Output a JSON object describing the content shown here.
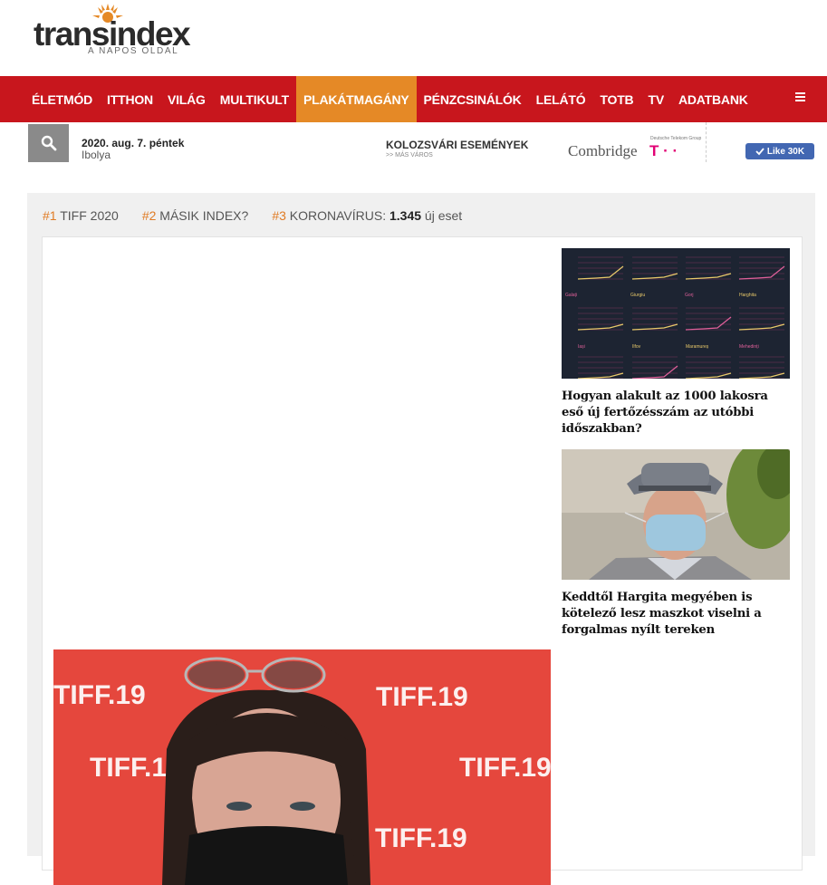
{
  "brand": {
    "name": "transindex",
    "tagline": "A NAPOS OLDAL"
  },
  "nav": {
    "items": [
      {
        "label": "ÉLETMÓD"
      },
      {
        "label": "ITTHON"
      },
      {
        "label": "VILÁG"
      },
      {
        "label": "MULTIKULT"
      },
      {
        "label": "PLAKÁTMAGÁNY",
        "active": true
      },
      {
        "label": "PÉNZCSINÁLÓK"
      },
      {
        "label": "LELÁTÓ"
      },
      {
        "label": "TOTB"
      },
      {
        "label": "TV"
      },
      {
        "label": "ADATBANK"
      }
    ],
    "menu_icon": "hamburger-icon"
  },
  "utility": {
    "search_icon": "search-icon",
    "date": "2020. aug. 7. péntek",
    "nameday": "Ibolya",
    "events_title": "KOLOZSVÁRI ESEMÉNYEK",
    "events_sub": ">> MÁS VÁROS",
    "sponsor_name": "Combridge",
    "sponsor_group": "Deutsche Telekom Group",
    "sponsor_logo": "T · ·",
    "like_label": "Like 30K"
  },
  "trending": [
    {
      "num": "#1",
      "label": "TIFF 2020"
    },
    {
      "num": "#2",
      "label": "MÁSIK INDEX?"
    },
    {
      "num": "#3",
      "label": "KORONAVÍRUS:",
      "bold": "1.345",
      "suffix": "új eset"
    }
  ],
  "side_articles": [
    {
      "title": "Hogyan alakult az 1000 lakosra eső új fertőzésszám az utóbbi időszakban?",
      "chart_labels": [
        "Galați",
        "Giurgiu",
        "Gorj",
        "Harghita",
        "Iași",
        "Ilfov",
        "Maramureș",
        "Mehedinți"
      ]
    },
    {
      "title": "Keddtől Hargita megyében is kötelező lesz maszkot viselni a forgalmas nyílt tereken"
    }
  ],
  "main_image": {
    "backdrop_text": "TIFF.19"
  },
  "colors": {
    "nav_red": "#c8161d",
    "nav_active": "#e58926",
    "trend_orange": "#e07b24",
    "fb_blue": "#4267b2",
    "magenta": "#e20074"
  }
}
